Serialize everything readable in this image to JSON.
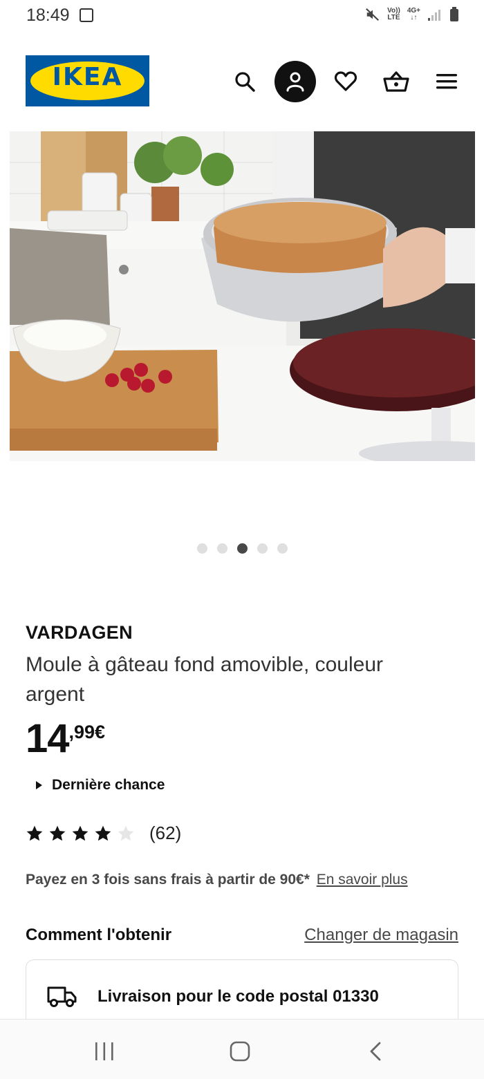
{
  "status_bar": {
    "time": "18:49",
    "network_top": "Vo))",
    "network_bottom": "LTE",
    "network_type": "4G+"
  },
  "header": {
    "logo_text": "IKEA",
    "icons": [
      "search-icon",
      "account-icon",
      "heart-icon",
      "basket-icon",
      "menu-icon"
    ]
  },
  "gallery": {
    "image_count": 5,
    "active_index": 2
  },
  "product": {
    "brand": "VARDAGEN",
    "description": "Moule à gâteau fond amovible, couleur argent",
    "price_integer": "14",
    "price_decimal": ",99€",
    "last_chance": "Dernière chance",
    "rating": 4,
    "rating_max": 5,
    "review_count": "(62)",
    "payment_text": "Payez en 3 fois sans frais à partir de 90€*",
    "payment_link": "En savoir plus"
  },
  "availability": {
    "title": "Comment l'obtenir",
    "change_store": "Changer de magasin",
    "delivery_label": "Livraison pour le code postal 01330"
  },
  "colors": {
    "ikea_blue": "#0058a3",
    "ikea_yellow": "#ffdb00"
  }
}
